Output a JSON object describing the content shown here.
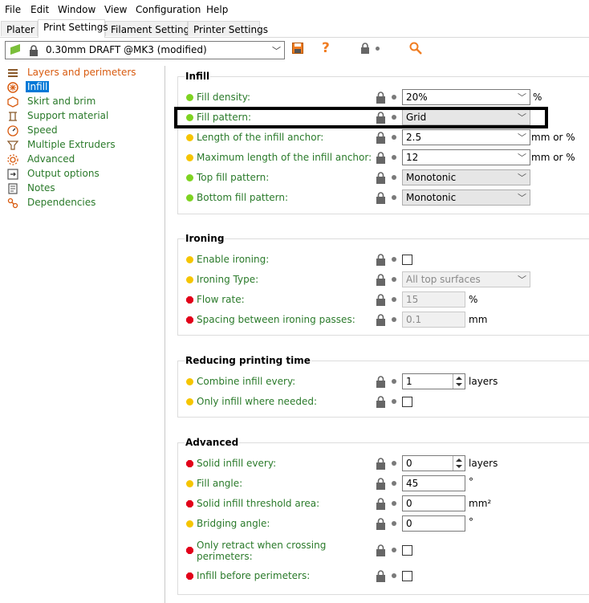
{
  "menu": [
    "File",
    "Edit",
    "Window",
    "View",
    "Configuration",
    "Help"
  ],
  "tabs": [
    "Plater",
    "Print Settings",
    "Filament Settings",
    "Printer Settings"
  ],
  "preset": "0.30mm DRAFT @MK3 (modified)",
  "toolbar_icons": [
    "save-icon",
    "help-icon",
    "lock-icon",
    "search-icon"
  ],
  "nav": [
    {
      "label": "Layers and perimeters",
      "icon": "layers-icon"
    },
    {
      "label": "Infill",
      "icon": "infill-icon"
    },
    {
      "label": "Skirt and brim",
      "icon": "skirt-icon"
    },
    {
      "label": "Support material",
      "icon": "support-icon"
    },
    {
      "label": "Speed",
      "icon": "speed-icon"
    },
    {
      "label": "Multiple Extruders",
      "icon": "extruders-icon"
    },
    {
      "label": "Advanced",
      "icon": "advanced-icon"
    },
    {
      "label": "Output options",
      "icon": "output-icon"
    },
    {
      "label": "Notes",
      "icon": "notes-icon"
    },
    {
      "label": "Dependencies",
      "icon": "dependencies-icon"
    }
  ],
  "groups": {
    "infill": {
      "title": "Infill",
      "rows": [
        {
          "label": "Fill density:",
          "value": "20%",
          "unit": "%"
        },
        {
          "label": "Fill pattern:",
          "value": "Grid"
        },
        {
          "label": "Length of the infill anchor:",
          "value": "2.5",
          "unit": "mm or %"
        },
        {
          "label": "Maximum length of the infill anchor:",
          "value": "12",
          "unit": "mm or %"
        },
        {
          "label": "Top fill pattern:",
          "value": "Monotonic"
        },
        {
          "label": "Bottom fill pattern:",
          "value": "Monotonic"
        }
      ]
    },
    "ironing": {
      "title": "Ironing",
      "rows": [
        {
          "label": "Enable ironing:"
        },
        {
          "label": "Ironing Type:",
          "value": "All top surfaces"
        },
        {
          "label": "Flow rate:",
          "value": "15",
          "unit": "%"
        },
        {
          "label": "Spacing between ironing passes:",
          "value": "0.1",
          "unit": "mm"
        }
      ]
    },
    "reducing": {
      "title": "Reducing printing time",
      "rows": [
        {
          "label": "Combine infill every:",
          "value": "1",
          "unit": "layers"
        },
        {
          "label": "Only infill where needed:"
        }
      ]
    },
    "advanced": {
      "title": "Advanced",
      "rows": [
        {
          "label": "Solid infill every:",
          "value": "0",
          "unit": "layers"
        },
        {
          "label": "Fill angle:",
          "value": "45",
          "unit": "°"
        },
        {
          "label": "Solid infill threshold area:",
          "value": "0",
          "unit": "mm²"
        },
        {
          "label": "Bridging angle:",
          "value": "0",
          "unit": "°"
        },
        {
          "label": "Only retract when crossing perimeters:"
        },
        {
          "label": "Infill before perimeters:"
        }
      ]
    }
  },
  "colors": {
    "simple": "#7ed321",
    "advanced": "#f5c500",
    "expert": "#e2001a",
    "label": "#2a7a2a",
    "selection": "#0078d7"
  }
}
